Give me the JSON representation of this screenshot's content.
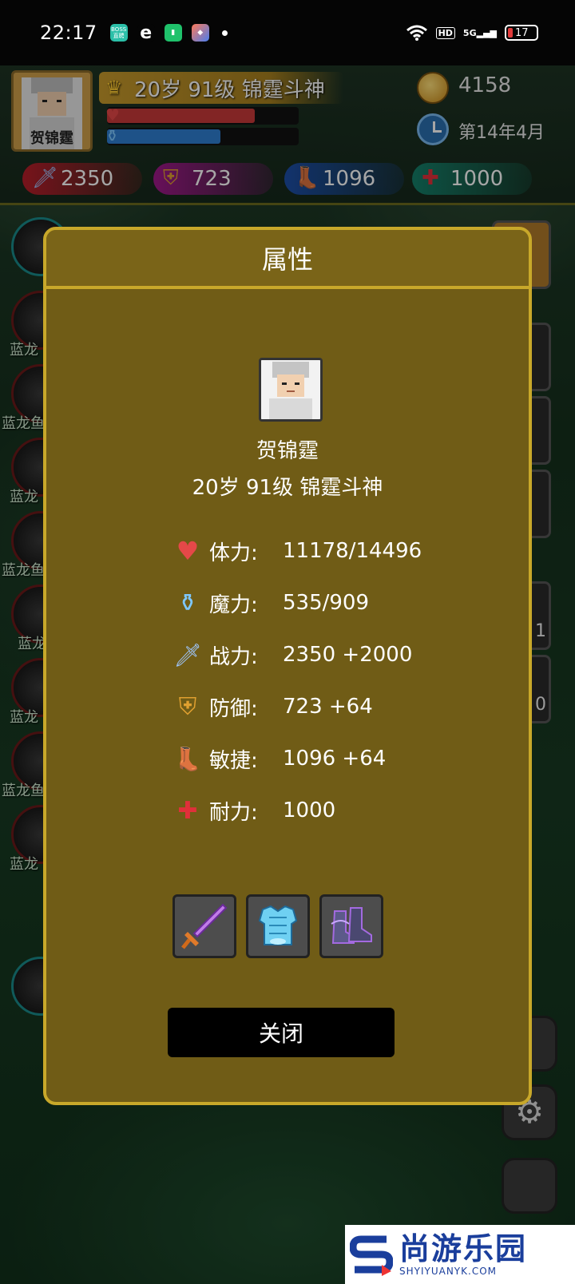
{
  "status_bar": {
    "time": "22:17",
    "app_icons": [
      {
        "name": "boss-app-icon",
        "label": "BOSS\n直聘",
        "color": "#2bbfa8"
      },
      {
        "name": "e-app-icon",
        "label": "e",
        "color": "#111111"
      },
      {
        "name": "battery-app-icon",
        "label": "",
        "color": "#1fc26b"
      },
      {
        "name": "gallery-app-icon",
        "label": "",
        "color": "#4a7ef0"
      }
    ],
    "network": "5G",
    "hd": "HD",
    "battery": "17"
  },
  "hud": {
    "avatar_name": "贺锦霆",
    "title": "20岁 91级 锦霆斗神",
    "hp_fraction": 0.77,
    "mp_fraction": 0.59,
    "gold": "4158",
    "date": "第14年4月",
    "stats": [
      {
        "name": "attack",
        "icon": "sword-icon",
        "value": "2350",
        "color": "#b81e2a"
      },
      {
        "name": "defense",
        "icon": "shield-icon",
        "value": "723",
        "color": "#a0198a"
      },
      {
        "name": "agility",
        "icon": "boot-icon",
        "value": "1096",
        "color": "#1c4fa8"
      },
      {
        "name": "stamina",
        "icon": "health-heart-icon",
        "value": "1000",
        "color": "#15806a"
      }
    ]
  },
  "side_labels": [
    "蓝龙",
    "蓝龙鱼",
    "蓝龙",
    "蓝龙鱼",
    "蓝龙",
    "蓝龙",
    "蓝龙鱼",
    "蓝龙"
  ],
  "right_numbers": [
    "1",
    "0"
  ],
  "modal": {
    "title": "属性",
    "name": "贺锦霆",
    "subtitle": "20岁 91级 锦霆斗神",
    "attributes": [
      {
        "icon": "heart-icon",
        "label": "体力:",
        "value": "11178/14496"
      },
      {
        "icon": "mana-potion-icon",
        "label": "魔力:",
        "value": "535/909"
      },
      {
        "icon": "sword-icon",
        "label": "战力:",
        "value": "2350 +2000"
      },
      {
        "icon": "shield-icon",
        "label": "防御:",
        "value": "723 +64"
      },
      {
        "icon": "boot-icon",
        "label": "敏捷:",
        "value": "1096 +64"
      },
      {
        "icon": "health-heart-icon",
        "label": "耐力:",
        "value": "1000"
      }
    ],
    "equipment": [
      {
        "name": "equip-sword",
        "icon": "purple-sword-icon"
      },
      {
        "name": "equip-armor",
        "icon": "ice-armor-icon"
      },
      {
        "name": "equip-boots",
        "icon": "shadow-boots-icon"
      }
    ],
    "close_label": "关闭"
  },
  "watermark": {
    "title": "尚游乐园",
    "url": "SHYIYUANYK.COM"
  }
}
